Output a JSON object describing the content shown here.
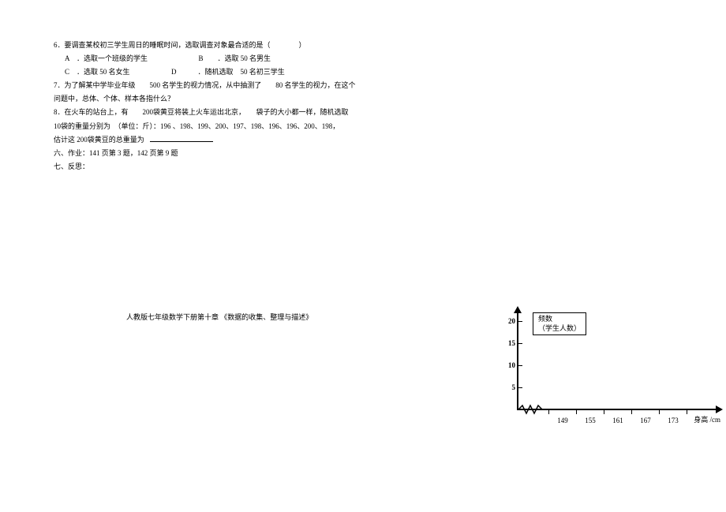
{
  "q6": {
    "stem": "6．要调查某校初三学生周日的睡眠时间，选取调查对象最合适的是（　　　　）",
    "optA": "A　．选取一个班级的学生",
    "optB": "B　　．选取 50 名男生",
    "optC": "C　．选取 50 名女生",
    "optD": "D　　　．随机选取　50 名初三学生"
  },
  "q7": {
    "line1": "7．为了解某中学毕业年级　　500 名学生的视力情况，从中抽测了　　80 名学生的视力，在这个",
    "line2": "问题中，总体、个体、样本各指什么？"
  },
  "q8": {
    "line1": "8．在火车的站台上，有　　200袋黄豆将装上火车运出北京，　　袋子的大小都一样，随机选取",
    "line2": "10袋的重量分别为　（单位：斤）：196 、198、199、200、197、198、196、196、200、198，",
    "line3_prefix": "估计这 200袋黄豆的总重量为"
  },
  "section6": "六、作业：141 页第 3 题，142 页第 9 题",
  "section7": "七、反思：",
  "footer": "人教版七年级数学下册第十章 《数据的收集、整理与描述》",
  "chart_data": {
    "type": "bar",
    "y_title_line1": "频数",
    "y_title_line2": "（学生人数）",
    "x_title": "身高 /cm",
    "y_ticks": [
      5,
      10,
      15,
      20
    ],
    "x_ticks": [
      149,
      155,
      161,
      167,
      173
    ],
    "ylim": [
      0,
      22
    ],
    "note": "轴与刻度绘出，柱形未绘出"
  }
}
